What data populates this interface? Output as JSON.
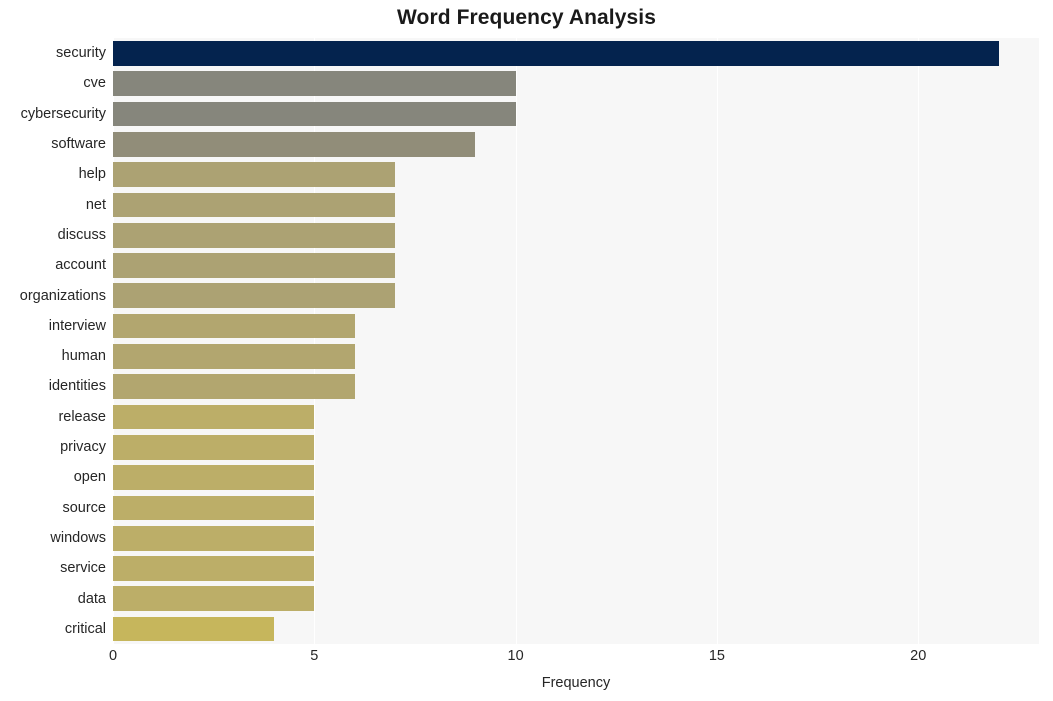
{
  "chart_data": {
    "type": "bar",
    "orientation": "horizontal",
    "title": "Word Frequency Analysis",
    "xlabel": "Frequency",
    "ylabel": "",
    "categories": [
      "security",
      "cve",
      "cybersecurity",
      "software",
      "help",
      "net",
      "discuss",
      "account",
      "organizations",
      "interview",
      "human",
      "identities",
      "release",
      "privacy",
      "open",
      "source",
      "windows",
      "service",
      "data",
      "critical"
    ],
    "values": [
      22,
      10,
      10,
      9,
      7,
      7,
      7,
      7,
      7,
      6,
      6,
      6,
      5,
      5,
      5,
      5,
      5,
      5,
      5,
      4
    ],
    "xlim": [
      0,
      23
    ],
    "xticks": [
      0,
      5,
      10,
      15,
      20
    ],
    "xtick_labels": [
      "0",
      "5",
      "10",
      "15",
      "20"
    ],
    "grid": true,
    "grid_axis": "x",
    "legend": "none",
    "bar_colors": [
      "#04234e",
      "#86867c",
      "#86867c",
      "#918d79",
      "#aca273",
      "#aca273",
      "#aca273",
      "#aca273",
      "#aca273",
      "#b2a66f",
      "#b2a66f",
      "#b2a66f",
      "#bcae68",
      "#bcae68",
      "#bcae68",
      "#bcae68",
      "#bcae68",
      "#bcae68",
      "#bcae68",
      "#c6b65c"
    ],
    "plot_background": "#f7f7f7",
    "grid_color": "#ffffff",
    "figure_background": "#ffffff",
    "text_color": "#262626"
  }
}
